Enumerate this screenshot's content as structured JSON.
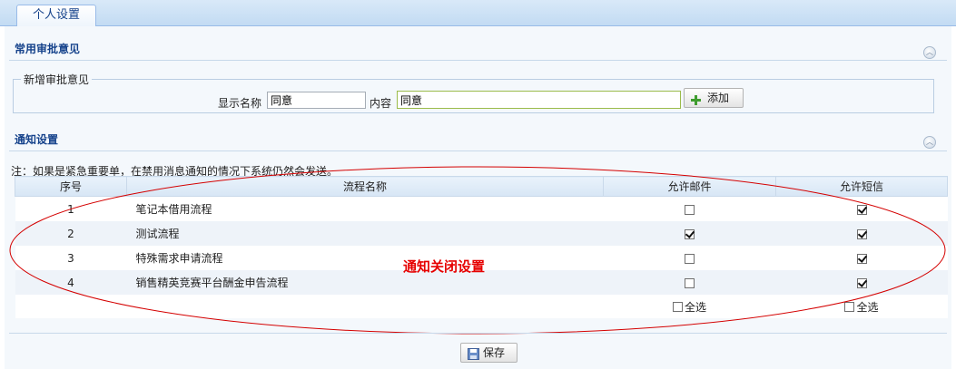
{
  "tabs": [
    {
      "label": "个人设置"
    }
  ],
  "approval_section": {
    "title": "常用审批意见",
    "fieldset_legend": "新增审批意见",
    "display_name_label": "显示名称",
    "display_name_value": "同意",
    "content_label": "内容",
    "content_value": "同意",
    "add_button": "添加"
  },
  "notify_section": {
    "title": "通知设置",
    "note": "注：如果是紧急重要单，在禁用消息通知的情况下系统仍然会发送。",
    "columns": [
      "序号",
      "流程名称",
      "允许邮件",
      "允许短信"
    ],
    "rows": [
      {
        "no": "1",
        "name": "笔记本借用流程",
        "email": false,
        "sms": true
      },
      {
        "no": "2",
        "name": "测试流程",
        "email": true,
        "sms": true
      },
      {
        "no": "3",
        "name": "特殊需求申请流程",
        "email": false,
        "sms": true
      },
      {
        "no": "4",
        "name": "销售精英竞赛平台酬金申告流程",
        "email": false,
        "sms": true
      }
    ],
    "select_all_email": "全选",
    "select_all_sms": "全选"
  },
  "annotation": {
    "text": "通知关闭设置",
    "color": "#e60000"
  },
  "save_button": "保存",
  "colors": {
    "accent": "#15428b",
    "tab_bar": "#c2dbf3"
  }
}
